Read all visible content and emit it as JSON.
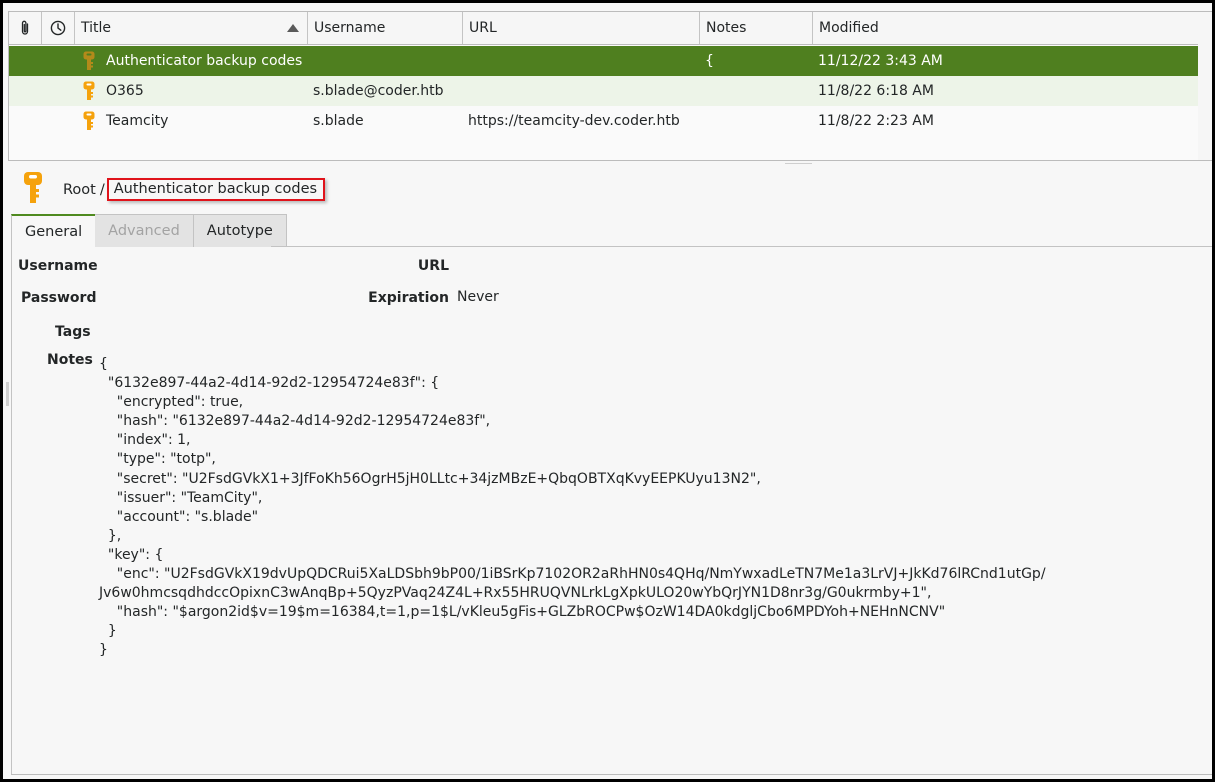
{
  "table": {
    "columns": [
      {
        "key": "attachment",
        "label": "",
        "icon": "paperclip-icon"
      },
      {
        "key": "modified_time",
        "label": "",
        "icon": "clock-icon"
      },
      {
        "key": "title",
        "label": "Title",
        "sort": "ascending"
      },
      {
        "key": "username",
        "label": "Username"
      },
      {
        "key": "url",
        "label": "URL"
      },
      {
        "key": "notes",
        "label": "Notes"
      },
      {
        "key": "modified",
        "label": "Modified"
      }
    ],
    "rows": [
      {
        "title": "Authenticator backup codes",
        "username": "",
        "url": "",
        "notes": "{",
        "modified": "11/12/22 3:43 AM",
        "selected": true
      },
      {
        "title": "O365",
        "username": "s.blade@coder.htb",
        "url": "",
        "notes": "",
        "modified": "11/8/22 6:18 AM",
        "selected": false
      },
      {
        "title": "Teamcity",
        "username": "s.blade",
        "url": "https://teamcity-dev.coder.htb",
        "notes": "",
        "modified": "11/8/22 2:23 AM",
        "selected": false
      }
    ]
  },
  "entry": {
    "breadcrumb": {
      "group": "Root",
      "separator": "/",
      "title": "Authenticator backup codes"
    },
    "tabs": [
      {
        "label": "General",
        "active": true,
        "enabled": true
      },
      {
        "label": "Advanced",
        "active": false,
        "enabled": false
      },
      {
        "label": "Autotype",
        "active": false,
        "enabled": true
      }
    ],
    "fields": {
      "username_label": "Username",
      "username_value": "",
      "url_label": "URL",
      "url_value": "",
      "password_label": "Password",
      "password_value": "",
      "expiration_label": "Expiration",
      "expiration_value": "Never",
      "tags_label": "Tags",
      "tags_value": "",
      "notes_label": "Notes",
      "notes_value": "{\n  \"6132e897-44a2-4d14-92d2-12954724e83f\": {\n    \"encrypted\": true,\n    \"hash\": \"6132e897-44a2-4d14-92d2-12954724e83f\",\n    \"index\": 1,\n    \"type\": \"totp\",\n    \"secret\": \"U2FsdGVkX1+3JfFoKh56OgrH5jH0LLtc+34jzMBzE+QbqOBTXqKvyEEPKUyu13N2\",\n    \"issuer\": \"TeamCity\",\n    \"account\": \"s.blade\"\n  },\n  \"key\": {\n    \"enc\": \"U2FsdGVkX19dvUpQDCRui5XaLDSbh9bP00/1iBSrKp7102OR2aRhHN0s4QHq/NmYwxadLeTN7Me1a3LrVJ+JkKd76lRCnd1utGp/\nJv6w0hmcsqdhdccOpixnC3wAnqBp+5QyzPVaq24Z4L+Rx55HRUQVNLrkLgXpkULO20wYbQrJYN1D8nr3g/G0ukrmby+1\",\n    \"hash\": \"$argon2id$v=19$m=16384,t=1,p=1$L/vKleu5gFis+GLZbROCPw$OzW14DA0kdgljCbo6MPDYoh+NEHnNCNV\"\n  }\n}"
    }
  },
  "colors": {
    "selection": "#4f7f1f",
    "alternate_row": "#edf4e8",
    "key_icon": "#f5a20c",
    "highlight_box": "#e0131b",
    "active_tab_accent": "#4f8a1f"
  }
}
